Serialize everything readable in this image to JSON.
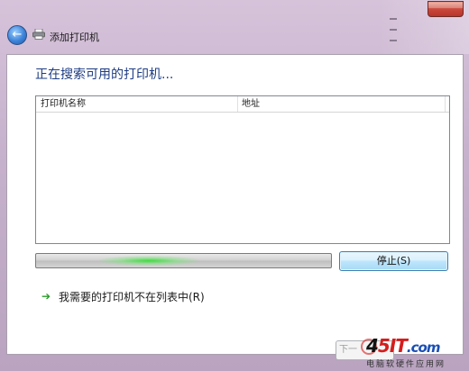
{
  "window": {
    "title": "添加打印机"
  },
  "main": {
    "heading": "正在搜索可用的打印机...",
    "columns": [
      "打印机名称",
      "地址"
    ],
    "progress_state": "indeterminate",
    "stop_label": "停止(S)",
    "link_label": "我需要的打印机不在列表中(R)"
  },
  "footer": {
    "next_label": "下一"
  },
  "watermark": {
    "logo_prefix": "4",
    "logo_mid": "5IT",
    "logo_suffix": ".com",
    "subtitle": "电脑软硬件应用网"
  },
  "icons": {
    "back": "back-arrow-icon",
    "printer": "printer-icon",
    "link_arrow": "green-arrow-icon"
  },
  "colors": {
    "heading": "#1e3c83",
    "progress_glow": "#3cdc3c",
    "close_button": "#c8453a"
  }
}
